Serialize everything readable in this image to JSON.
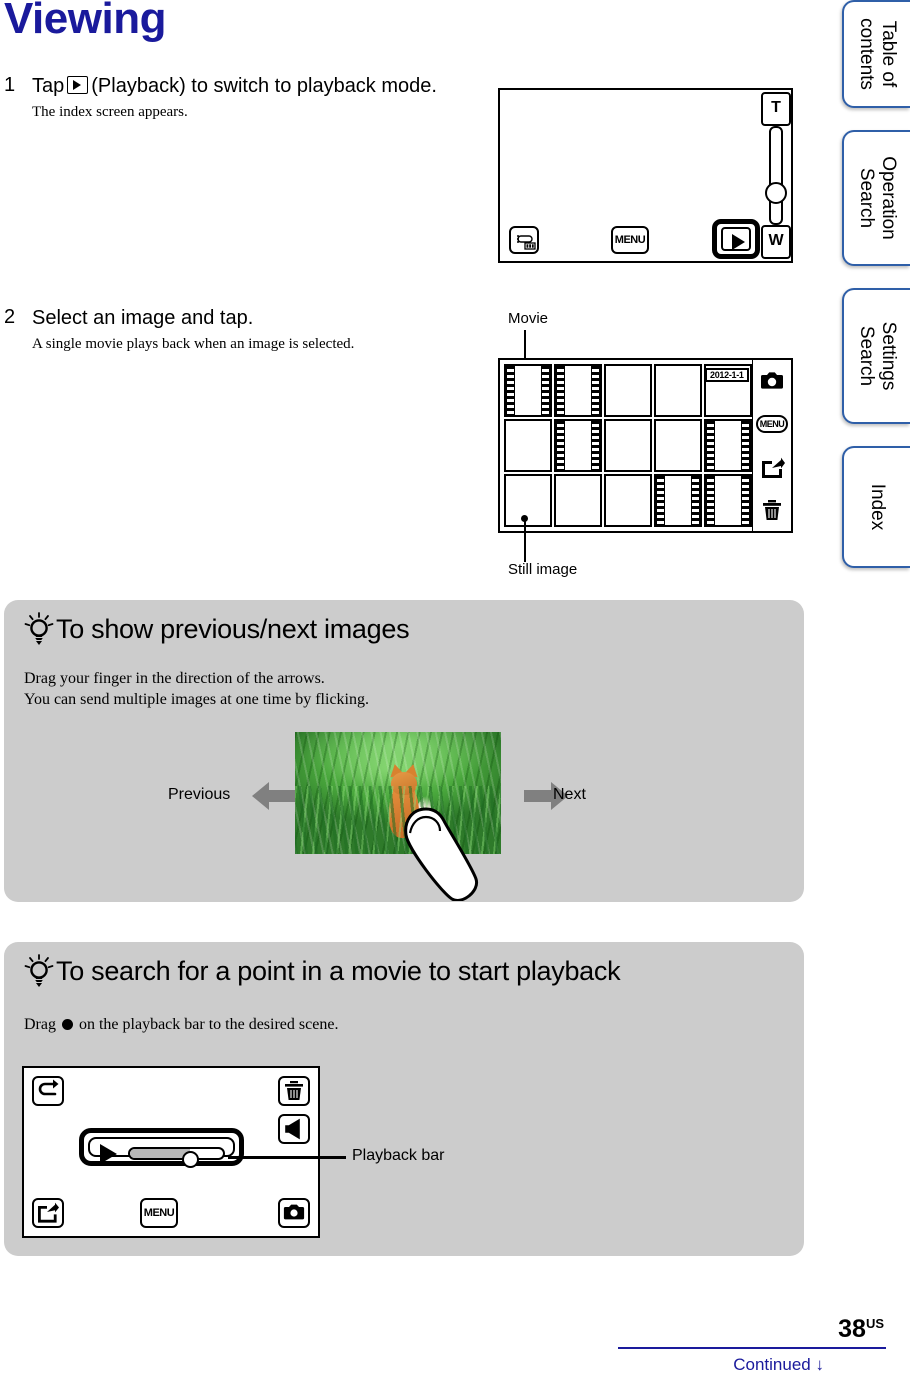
{
  "page": {
    "title": "Viewing",
    "number": "38",
    "region": "US",
    "continued": "Continued",
    "continued_arrow": "↓"
  },
  "steps": [
    {
      "num": "1",
      "text_before": "Tap",
      "icon": "playback-icon",
      "text_after": "(Playback) to switch to playback mode.",
      "sub": "The index screen appears."
    },
    {
      "num": "2",
      "text_before": "Select an image and tap.",
      "sub": "A single movie plays back when an image is selected."
    }
  ],
  "rec_screen": {
    "zoom_tele_label": "T",
    "zoom_wide_label": "W",
    "menu_label": "MENU",
    "camera_icon": "camera-battery-icon",
    "playback_icon": "playback-icon"
  },
  "index_screen": {
    "date_stamp": "2012-1-1",
    "menu_label": "MENU",
    "callouts": {
      "movie": "Movie",
      "still": "Still image"
    },
    "side_icons": [
      "camera-icon",
      "menu-icon",
      "share-icon",
      "trash-icon"
    ],
    "thumbnails": [
      [
        "movie",
        "movie",
        "still",
        "still",
        "still"
      ],
      [
        "still",
        "movie",
        "still",
        "still",
        "movie"
      ],
      [
        "still",
        "still",
        "still",
        "movie",
        "movie"
      ]
    ]
  },
  "tips": [
    {
      "heading": "To show previous/next images",
      "body_line1": "Drag your finger in the direction of the arrows.",
      "body_line2": "You can send multiple images at one time by flicking.",
      "arrow_prev_label": "Previous",
      "arrow_next_label": "Next"
    },
    {
      "heading": "To search for a point in a movie to start playback",
      "body_before": "Drag",
      "body_after": "on the playback bar to the desired scene.",
      "callout_label": "Playback bar",
      "menu_label": "MENU",
      "icons": [
        "back-icon",
        "trash-icon",
        "volume-icon",
        "share-icon",
        "camera-icon"
      ]
    }
  ],
  "sidebar": {
    "tabs": [
      {
        "label": "Table of\ncontents"
      },
      {
        "label": "Operation\nSearch"
      },
      {
        "label": "Settings\nSearch"
      },
      {
        "label": "Index"
      }
    ]
  },
  "colors": {
    "title_blue": "#1a1a9c",
    "tip_bg": "#cccccc",
    "tab_border": "#2f5fa8",
    "arrow_gray": "#808080"
  }
}
